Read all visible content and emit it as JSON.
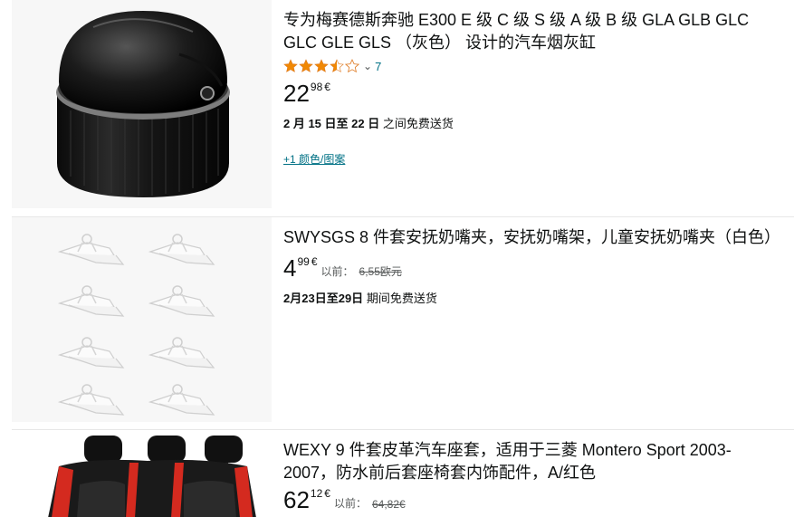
{
  "products": [
    {
      "title": "专为梅赛德斯奔驰 E300 E 级 C 级 S 级 A 级 B 级 GLA GLB GLC GLC GLE GLS （灰色） 设计的汽车烟灰缸",
      "rating": 3.5,
      "rating_chevron": "⌄",
      "review_count": "7",
      "price_whole": "22",
      "price_fraction": "98",
      "price_symbol": "€",
      "delivery_date1": "2 月 15 日",
      "delivery_mid": "至",
      "delivery_date2": "22 日",
      "delivery_suffix": "之间免费送货",
      "variant_link": "+1 颜色/图案",
      "image": "black-car-ashtray"
    },
    {
      "title": "SWYSGS 8 件套安抚奶嘴夹，安抚奶嘴架，儿童安抚奶嘴夹（白色）",
      "price_whole": "4",
      "price_fraction": "99",
      "price_symbol": "€",
      "prev_label": "以前：",
      "prev_price": "6,55欧元",
      "delivery_date1": "2月23日",
      "delivery_mid": "至",
      "delivery_date2": "29日",
      "delivery_suffix": "期间免费送货",
      "image": "white-pacifier-clips"
    },
    {
      "title": "WEXY 9 件套皮革汽车座套，适用于三菱 Montero Sport 2003-2007，防水前后套座椅套内饰配件，A/红色",
      "price_whole": "62",
      "price_fraction": "12",
      "price_symbol": "€",
      "prev_label": "以前：",
      "prev_price": "64,82€",
      "image": "black-red-leather-seat-covers"
    }
  ],
  "colors": {
    "link": "#007185",
    "star": "#f08804",
    "text": "#0f1111",
    "muted": "#565959",
    "thumb_bg": "#f7f7f7"
  }
}
